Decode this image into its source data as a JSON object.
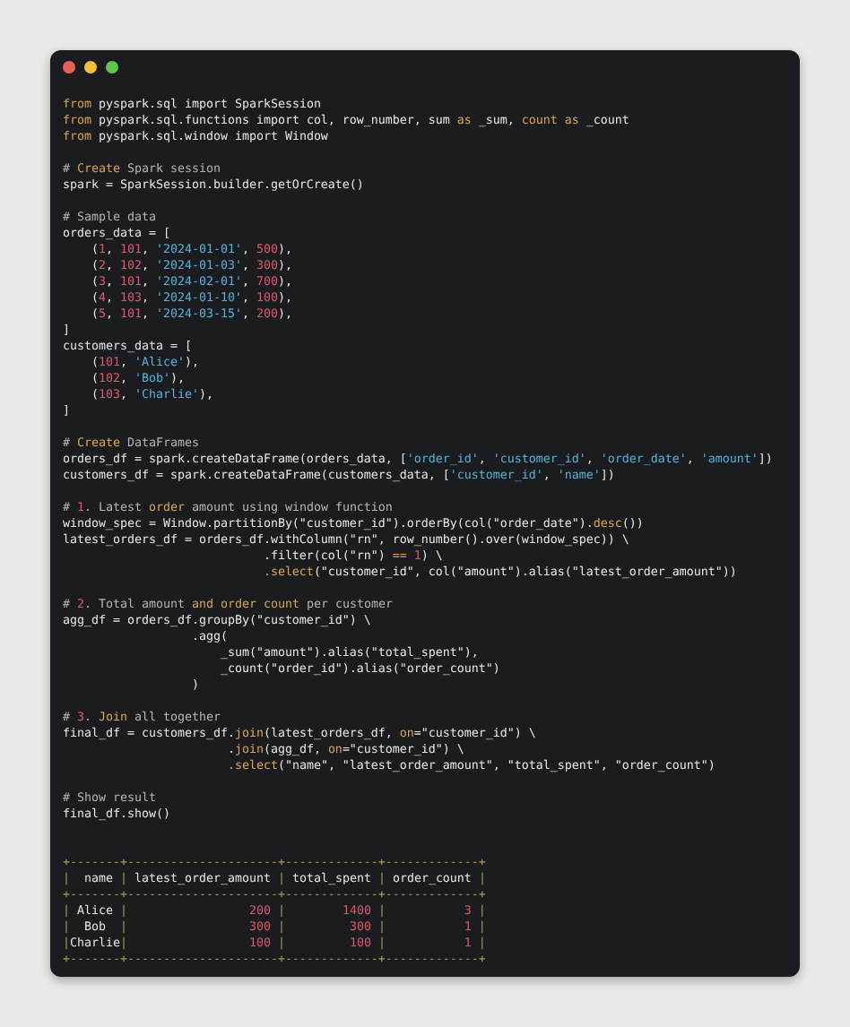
{
  "editor": {
    "lines": [
      {
        "kind": "code",
        "segments": [
          {
            "t": "from",
            "kind": "keyword"
          },
          {
            "t": " pyspark.sql import SparkSession"
          }
        ]
      },
      {
        "kind": "code",
        "segments": [
          {
            "t": "from",
            "kind": "keyword"
          },
          {
            "t": " pyspark.sql.functions import col, row_number, sum "
          },
          {
            "t": "as",
            "kind": "keyword"
          },
          {
            "t": " _sum, "
          },
          {
            "t": "count as",
            "kind": "keyword"
          },
          {
            "t": " _count"
          }
        ]
      },
      {
        "kind": "code",
        "segments": [
          {
            "t": "from",
            "kind": "keyword"
          },
          {
            "t": " pyspark.sql.window import Window"
          }
        ]
      },
      {
        "kind": "blank"
      },
      {
        "kind": "code",
        "segments": [
          {
            "t": "# ",
            "kind": "comment"
          },
          {
            "t": "Create",
            "kind": "keyword"
          },
          {
            "t": " Spark session",
            "kind": "comment"
          }
        ]
      },
      {
        "kind": "code",
        "segments": [
          {
            "t": "spark = SparkSession.builder.getOrCreate()"
          }
        ]
      },
      {
        "kind": "blank"
      },
      {
        "kind": "code",
        "segments": [
          {
            "t": "# Sample data",
            "kind": "comment"
          }
        ]
      },
      {
        "kind": "code",
        "segments": [
          {
            "t": "orders_data = ["
          }
        ]
      },
      {
        "kind": "code",
        "segments": [
          {
            "t": "    ("
          },
          {
            "t": "1",
            "kind": "number"
          },
          {
            "t": ", "
          },
          {
            "t": "101",
            "kind": "number"
          },
          {
            "t": ", "
          },
          {
            "t": "'2024-01-01'",
            "kind": "string"
          },
          {
            "t": ", "
          },
          {
            "t": "500",
            "kind": "number"
          },
          {
            "t": "),"
          }
        ]
      },
      {
        "kind": "code",
        "segments": [
          {
            "t": "    ("
          },
          {
            "t": "2",
            "kind": "number"
          },
          {
            "t": ", "
          },
          {
            "t": "102",
            "kind": "number"
          },
          {
            "t": ", "
          },
          {
            "t": "'2024-01-03'",
            "kind": "string"
          },
          {
            "t": ", "
          },
          {
            "t": "300",
            "kind": "number"
          },
          {
            "t": "),"
          }
        ]
      },
      {
        "kind": "code",
        "segments": [
          {
            "t": "    ("
          },
          {
            "t": "3",
            "kind": "number"
          },
          {
            "t": ", "
          },
          {
            "t": "101",
            "kind": "number"
          },
          {
            "t": ", "
          },
          {
            "t": "'2024-02-01'",
            "kind": "string"
          },
          {
            "t": ", "
          },
          {
            "t": "700",
            "kind": "number"
          },
          {
            "t": "),"
          }
        ]
      },
      {
        "kind": "code",
        "segments": [
          {
            "t": "    ("
          },
          {
            "t": "4",
            "kind": "number"
          },
          {
            "t": ", "
          },
          {
            "t": "103",
            "kind": "number"
          },
          {
            "t": ", "
          },
          {
            "t": "'2024-01-10'",
            "kind": "string"
          },
          {
            "t": ", "
          },
          {
            "t": "100",
            "kind": "number"
          },
          {
            "t": "),"
          }
        ]
      },
      {
        "kind": "code",
        "segments": [
          {
            "t": "    ("
          },
          {
            "t": "5",
            "kind": "number"
          },
          {
            "t": ", "
          },
          {
            "t": "101",
            "kind": "number"
          },
          {
            "t": ", "
          },
          {
            "t": "'2024-03-15'",
            "kind": "string"
          },
          {
            "t": ", "
          },
          {
            "t": "200",
            "kind": "number"
          },
          {
            "t": "),"
          }
        ]
      },
      {
        "kind": "code",
        "segments": [
          {
            "t": "]"
          }
        ]
      },
      {
        "kind": "code",
        "segments": [
          {
            "t": "customers_data = ["
          }
        ]
      },
      {
        "kind": "code",
        "segments": [
          {
            "t": "    ("
          },
          {
            "t": "101",
            "kind": "number"
          },
          {
            "t": ", "
          },
          {
            "t": "'Alice'",
            "kind": "string"
          },
          {
            "t": "),"
          }
        ]
      },
      {
        "kind": "code",
        "segments": [
          {
            "t": "    ("
          },
          {
            "t": "102",
            "kind": "number"
          },
          {
            "t": ", "
          },
          {
            "t": "'Bob'",
            "kind": "string"
          },
          {
            "t": "),"
          }
        ]
      },
      {
        "kind": "code",
        "segments": [
          {
            "t": "    ("
          },
          {
            "t": "103",
            "kind": "number"
          },
          {
            "t": ", "
          },
          {
            "t": "'Charlie'",
            "kind": "string"
          },
          {
            "t": "),"
          }
        ]
      },
      {
        "kind": "code",
        "segments": [
          {
            "t": "]"
          }
        ]
      },
      {
        "kind": "blank"
      },
      {
        "kind": "code",
        "segments": [
          {
            "t": "# ",
            "kind": "comment"
          },
          {
            "t": "Create",
            "kind": "keyword"
          },
          {
            "t": " DataFrames",
            "kind": "comment"
          }
        ]
      },
      {
        "kind": "code",
        "segments": [
          {
            "t": "orders_df = spark.createDataFrame(orders_data, ["
          },
          {
            "t": "'order_id'",
            "kind": "string"
          },
          {
            "t": ", "
          },
          {
            "t": "'customer_id'",
            "kind": "string"
          },
          {
            "t": ", "
          },
          {
            "t": "'order_date'",
            "kind": "string"
          },
          {
            "t": ", "
          },
          {
            "t": "'amount'",
            "kind": "string"
          },
          {
            "t": "])"
          }
        ]
      },
      {
        "kind": "code",
        "segments": [
          {
            "t": "customers_df = spark.createDataFrame(customers_data, ["
          },
          {
            "t": "'customer_id'",
            "kind": "string"
          },
          {
            "t": ", "
          },
          {
            "t": "'name'",
            "kind": "string"
          },
          {
            "t": "])"
          }
        ]
      },
      {
        "kind": "blank"
      },
      {
        "kind": "code",
        "segments": [
          {
            "t": "# ",
            "kind": "comment"
          },
          {
            "t": "1",
            "kind": "number"
          },
          {
            "t": ". Latest ",
            "kind": "comment"
          },
          {
            "t": "order",
            "kind": "keyword"
          },
          {
            "t": " amount using window function",
            "kind": "comment"
          }
        ]
      },
      {
        "kind": "code",
        "segments": [
          {
            "t": "window_spec = Window.partitionBy(\"customer_id\").orderBy(col(\"order_date\")."
          },
          {
            "t": "desc",
            "kind": "keyword"
          },
          {
            "t": "())"
          }
        ]
      },
      {
        "kind": "code",
        "segments": [
          {
            "t": "latest_orders_df = orders_df.withColumn(\"rn\", row_number().over(window_spec)) \\"
          }
        ]
      },
      {
        "kind": "code",
        "segments": [
          {
            "t": "                            .filter(col(\"rn\") "
          },
          {
            "t": "==",
            "kind": "keyword"
          },
          {
            "t": " 1",
            "kind": "number"
          },
          {
            "t": ") \\"
          }
        ]
      },
      {
        "kind": "code",
        "segments": [
          {
            "t": "                            .select",
            "kind": "keyword"
          },
          {
            "t": "(\"customer_id\", col(\"amount\").alias(\"latest_order_amount\"))"
          }
        ]
      },
      {
        "kind": "blank"
      },
      {
        "kind": "code",
        "segments": [
          {
            "t": "# ",
            "kind": "comment"
          },
          {
            "t": "2",
            "kind": "number"
          },
          {
            "t": ". Total amount ",
            "kind": "comment"
          },
          {
            "t": "and order count",
            "kind": "keyword"
          },
          {
            "t": " per customer",
            "kind": "comment"
          }
        ]
      },
      {
        "kind": "code",
        "segments": [
          {
            "t": "agg_df = orders_df.groupBy(\"customer_id\") \\"
          }
        ]
      },
      {
        "kind": "code",
        "segments": [
          {
            "t": "                  .agg("
          }
        ]
      },
      {
        "kind": "code",
        "segments": [
          {
            "t": "                      _sum(\"amount\").alias(\"total_spent\"),"
          }
        ]
      },
      {
        "kind": "code",
        "segments": [
          {
            "t": "                      _count(\"order_id\").alias(\"order_count\")"
          }
        ]
      },
      {
        "kind": "code",
        "segments": [
          {
            "t": "                  )"
          }
        ]
      },
      {
        "kind": "blank"
      },
      {
        "kind": "code",
        "segments": [
          {
            "t": "# ",
            "kind": "comment"
          },
          {
            "t": "3",
            "kind": "number"
          },
          {
            "t": ". ",
            "kind": "comment"
          },
          {
            "t": "Join",
            "kind": "keyword"
          },
          {
            "t": " all together",
            "kind": "comment"
          }
        ]
      },
      {
        "kind": "code",
        "segments": [
          {
            "t": "final_df = customers_df."
          },
          {
            "t": "join",
            "kind": "keyword"
          },
          {
            "t": "(latest_orders_df, "
          },
          {
            "t": "on",
            "kind": "keyword"
          },
          {
            "t": "=\"customer_id\") \\"
          }
        ]
      },
      {
        "kind": "code",
        "segments": [
          {
            "t": "                       ."
          },
          {
            "t": "join",
            "kind": "keyword"
          },
          {
            "t": "(agg_df, "
          },
          {
            "t": "on",
            "kind": "keyword"
          },
          {
            "t": "=\"customer_id\") \\"
          }
        ]
      },
      {
        "kind": "code",
        "segments": [
          {
            "t": "                       .select",
            "kind": "keyword"
          },
          {
            "t": "(\"name\", \"latest_order_amount\", \"total_spent\", \"order_count\")"
          }
        ]
      },
      {
        "kind": "blank"
      },
      {
        "kind": "code",
        "segments": [
          {
            "t": "# Show result",
            "kind": "comment"
          }
        ]
      },
      {
        "kind": "code",
        "segments": [
          {
            "t": "final_df.show()"
          }
        ]
      },
      {
        "kind": "blank"
      },
      {
        "kind": "blank"
      },
      {
        "kind": "code",
        "segments": [
          {
            "t": "+-------+---------------------+-------------+-------------+",
            "kind": "border"
          }
        ]
      },
      {
        "kind": "code",
        "segments": [
          {
            "t": "|",
            "kind": "border"
          },
          {
            "t": "  name "
          },
          {
            "t": "|",
            "kind": "border"
          },
          {
            "t": " latest_order_amount "
          },
          {
            "t": "|",
            "kind": "border"
          },
          {
            "t": " total_spent "
          },
          {
            "t": "|",
            "kind": "border"
          },
          {
            "t": " order_count "
          },
          {
            "t": "|",
            "kind": "border"
          }
        ]
      },
      {
        "kind": "code",
        "segments": [
          {
            "t": "+-------+---------------------+-------------+-------------+",
            "kind": "border"
          }
        ]
      },
      {
        "kind": "code",
        "segments": [
          {
            "t": "|",
            "kind": "border"
          },
          {
            "t": " Alice "
          },
          {
            "t": "|",
            "kind": "border"
          },
          {
            "t": "                 200",
            "kind": "number"
          },
          {
            "t": " |",
            "kind": "border"
          },
          {
            "t": "        1400",
            "kind": "number"
          },
          {
            "t": " |",
            "kind": "border"
          },
          {
            "t": "           3",
            "kind": "number"
          },
          {
            "t": " |",
            "kind": "border"
          }
        ]
      },
      {
        "kind": "code",
        "segments": [
          {
            "t": "|",
            "kind": "border"
          },
          {
            "t": "  Bob  "
          },
          {
            "t": "|",
            "kind": "border"
          },
          {
            "t": "                 300",
            "kind": "number"
          },
          {
            "t": " |",
            "kind": "border"
          },
          {
            "t": "         300",
            "kind": "number"
          },
          {
            "t": " |",
            "kind": "border"
          },
          {
            "t": "           1",
            "kind": "number"
          },
          {
            "t": " |",
            "kind": "border"
          }
        ]
      },
      {
        "kind": "code",
        "segments": [
          {
            "t": "|",
            "kind": "border"
          },
          {
            "t": "Charlie"
          },
          {
            "t": "|",
            "kind": "border"
          },
          {
            "t": "                 100",
            "kind": "number"
          },
          {
            "t": " |",
            "kind": "border"
          },
          {
            "t": "         100",
            "kind": "number"
          },
          {
            "t": " |",
            "kind": "border"
          },
          {
            "t": "           1",
            "kind": "number"
          },
          {
            "t": " |",
            "kind": "border"
          }
        ]
      },
      {
        "kind": "code",
        "segments": [
          {
            "t": "+-------+---------------------+-------------+-------------+",
            "kind": "border"
          }
        ]
      }
    ]
  }
}
